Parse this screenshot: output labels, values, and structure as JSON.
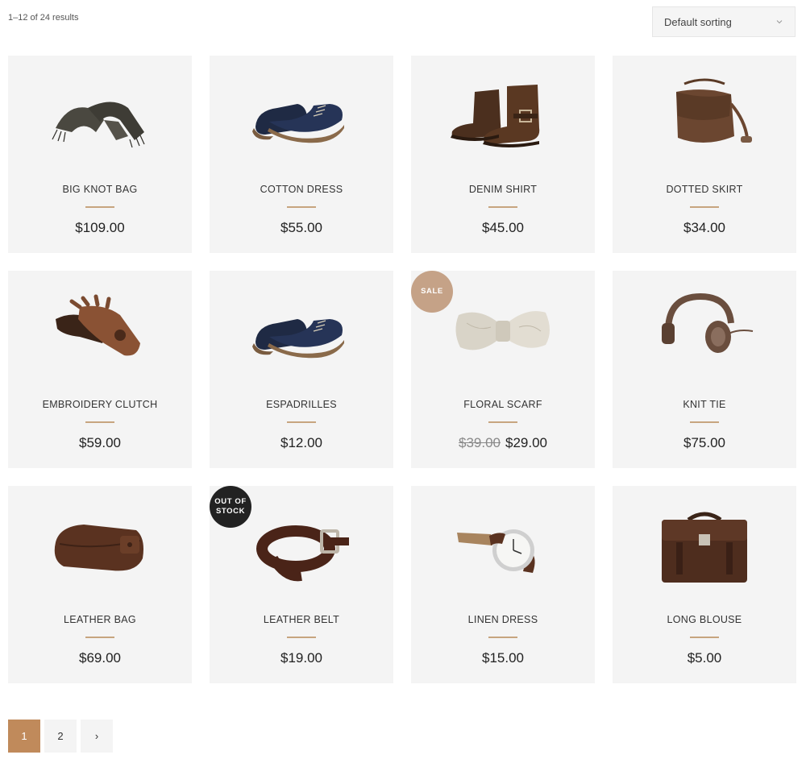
{
  "results_count": "1–12 of 24 results",
  "sort": {
    "selected": "Default sorting"
  },
  "colors": {
    "accent": "#c08a5b",
    "separator": "#c7a57f",
    "sale_badge": "#c5a287",
    "oos_badge": "#222222",
    "card_bg": "#f4f4f4"
  },
  "products": [
    {
      "name": "BIG KNOT BAG",
      "price": "$109.00",
      "icon": "scarf-icon"
    },
    {
      "name": "COTTON DRESS",
      "price": "$55.00",
      "icon": "shoes-icon"
    },
    {
      "name": "DENIM SHIRT",
      "price": "$45.00",
      "icon": "boots-icon"
    },
    {
      "name": "DOTTED SKIRT",
      "price": "$34.00",
      "icon": "shoulder-bag-icon"
    },
    {
      "name": "EMBROIDERY CLUTCH",
      "price": "$59.00",
      "icon": "gloves-icon"
    },
    {
      "name": "ESPADRILLES",
      "price": "$12.00",
      "icon": "shoes-icon"
    },
    {
      "name": "FLORAL SCARF",
      "old_price": "$39.00",
      "price": "$29.00",
      "badge": "SALE",
      "icon": "bow-scarf-icon"
    },
    {
      "name": "KNIT TIE",
      "price": "$75.00",
      "icon": "headphones-icon"
    },
    {
      "name": "LEATHER BAG",
      "price": "$69.00",
      "icon": "wallet-icon"
    },
    {
      "name": "LEATHER BELT",
      "price": "$19.00",
      "badge_line1": "OUT OF",
      "badge_line2": "STOCK",
      "icon": "belt-icon"
    },
    {
      "name": "LINEN DRESS",
      "price": "$15.00",
      "icon": "watch-icon"
    },
    {
      "name": "LONG BLOUSE",
      "price": "$5.00",
      "icon": "briefcase-icon"
    }
  ],
  "pagination": {
    "pages": [
      "1",
      "2"
    ],
    "next": "›",
    "current": "1"
  }
}
